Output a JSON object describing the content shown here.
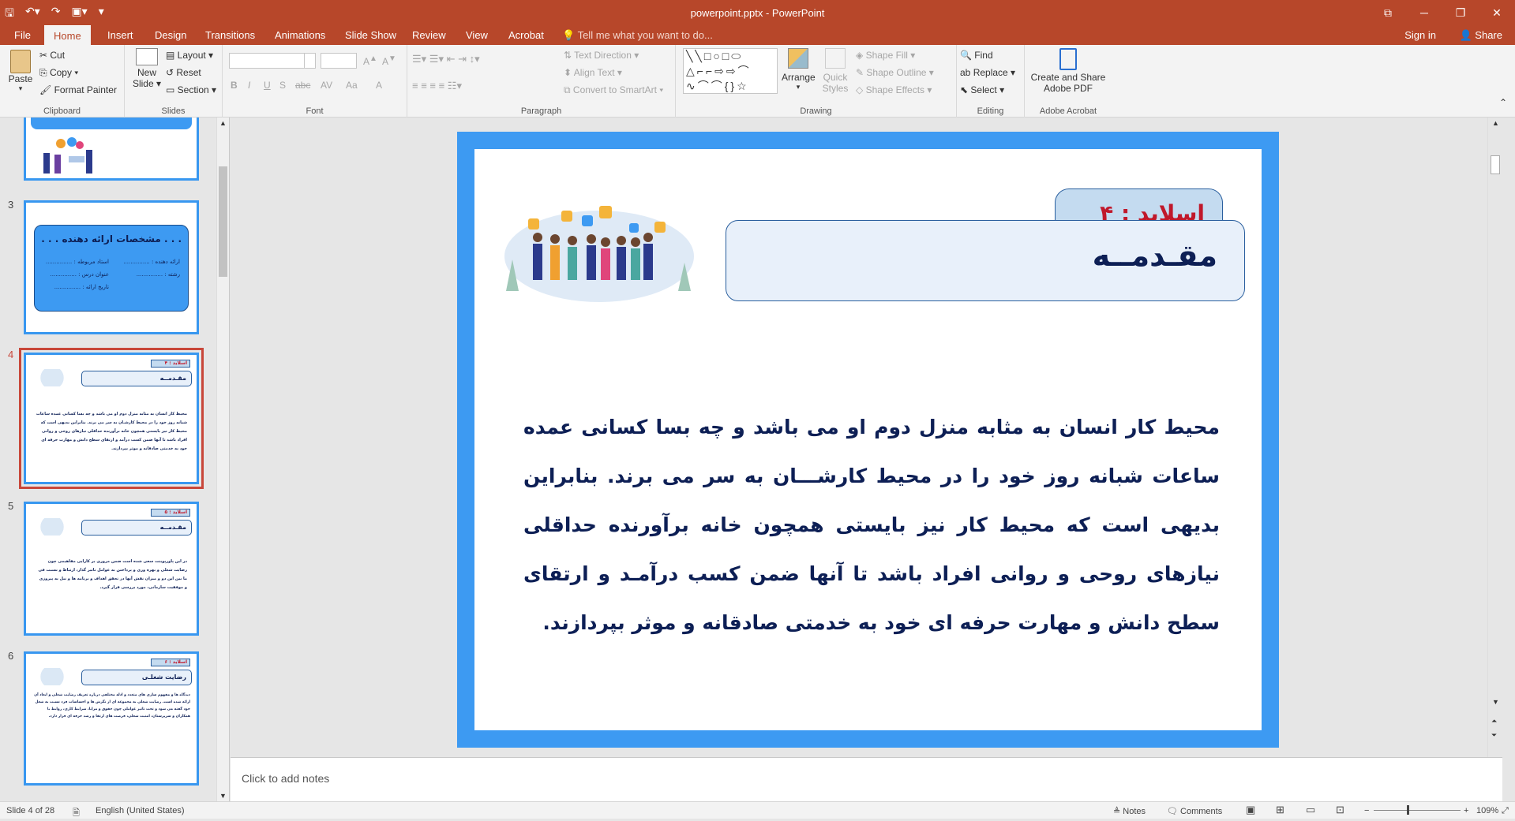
{
  "window": {
    "title": "powerpoint.pptx - PowerPoint"
  },
  "tabs": [
    "File",
    "Home",
    "Insert",
    "Design",
    "Transitions",
    "Animations",
    "Slide Show",
    "Review",
    "View",
    "Acrobat"
  ],
  "tell_me": "Tell me what you want to do...",
  "account": {
    "sign_in": "Sign in",
    "share": "Share"
  },
  "ribbon": {
    "clipboard": {
      "label": "Clipboard",
      "paste": "Paste",
      "cut": "Cut",
      "copy": "Copy",
      "format_painter": "Format Painter"
    },
    "slides": {
      "label": "Slides",
      "new_slide_1": "New",
      "new_slide_2": "Slide",
      "layout": "Layout",
      "reset": "Reset",
      "section": "Section"
    },
    "font": {
      "label": "Font",
      "bold": "B",
      "italic": "I",
      "underline": "U",
      "shadow": "S",
      "strike": "abc",
      "spacing": "AV",
      "case": "Aa",
      "color": "A"
    },
    "paragraph": {
      "label": "Paragraph",
      "text_direction": "Text Direction",
      "align_text": "Align Text",
      "smartart": "Convert to SmartArt"
    },
    "drawing": {
      "label": "Drawing",
      "arrange": "Arrange",
      "quick_styles_1": "Quick",
      "quick_styles_2": "Styles",
      "shape_fill": "Shape Fill",
      "shape_outline": "Shape Outline",
      "shape_effects": "Shape Effects"
    },
    "editing": {
      "label": "Editing",
      "find": "Find",
      "replace": "Replace",
      "select": "Select"
    },
    "acrobat": {
      "label": "Adobe Acrobat",
      "create_1": "Create and Share",
      "create_2": "Adobe PDF"
    }
  },
  "thumbnails": {
    "slide3_num": "3",
    "slide3_title": ". . . مشخصات ارائه دهنده . . .",
    "slide3_r1a": "ارائه دهنده : ...............",
    "slide3_r1b": "استاد مربوطه : ...............",
    "slide3_r2a": "رشته : ...............",
    "slide3_r2b": "عنوان درس : ...............",
    "slide3_r3": "تاریخ ارائه : ...............",
    "slide4_num": "4",
    "slide4_tag": "اسلاید : ۴",
    "slide4_title": "مقـدمــه",
    "slide4_text": "محیط کار انسان به مثابه منزل دوم او می باشد و چه بسا کسانی عمده ساعات شبانه روز خود را در محیط کارشـان به سر می برند. بنابراین بدیهی است که محیط کار نیز بایستی همچون خانه برآورنده حداقلی نیازهای روحی و روانی افراد باشد تا آنها ضمن کسب درآمد و ارتقای سطح دانش و مهارت حرفه ای خود به خدمتی صادقانه و موثر بپردازند.",
    "slide5_num": "5",
    "slide5_tag": "اسلاید : ۵",
    "slide5_title": "مقـدمــه",
    "slide5_text": "در این پاورپوینت سعی شده است ضمن مروری بر کارایی مفاهیمی چون رضایت شغلی و بهره وری و پرداختن به عوامل تاثیر گذار، ارتباط و نسبت فی ما بین این دو و میزان نقش آنها در تحقق اهداف و برنامه ها و نیل به پیروزی و موفقیت سازمانی، مورد بررسی قرار گیرد.",
    "slide6_num": "6",
    "slide6_tag": "اسلاید : ۶",
    "slide6_title": "رضایت شغلـی",
    "slide6_text": "دیدگاه ها و مفهوم سازی های متعدد و ادله مختلفی درباره تعریف رضایت شغلی و ابعاد آن ارائه شده است. رضایت شغلی به مجموعه ای از نگرش ها و احساسات فرد نسبت به شغل خود گفته می شود و تحت تاثیر عواملی چون حقوق و مزایا، شرایط کاری، روابط با همکاران و سرپرستان، امنیت شغلی، فرصت های ارتقا و رشد حرفه ای قرار دارد."
  },
  "slide": {
    "tag": "اسلاید :  ۴",
    "title": "مقـدمــه",
    "body": "محیط کار انسان به مثابه منزل دوم او می باشد و چه بسا کسانی عمده ساعات شبانه روز خود را در محیط کارشـــان به سر می برند. بنابراین بدیهی است که محیط کار نیز بایستی همچون خانه برآورنده حداقلی نیازهای روحی و روانی افراد باشد تا آنها ضمن کسب درآمـد و ارتقای سطح دانش و مهارت حرفه ای خود به خدمتی صادقانه و موثر بپردازند."
  },
  "notes_placeholder": "Click to add notes",
  "status": {
    "slide_of": "Slide 4 of 28",
    "language": "English (United States)",
    "notes": "Notes",
    "comments": "Comments",
    "zoom": "109%"
  },
  "colors": {
    "accent": "#b7472a",
    "slide_frame": "#3d9af2",
    "title_text": "#0d1f55",
    "tag_text": "#c0182b"
  }
}
